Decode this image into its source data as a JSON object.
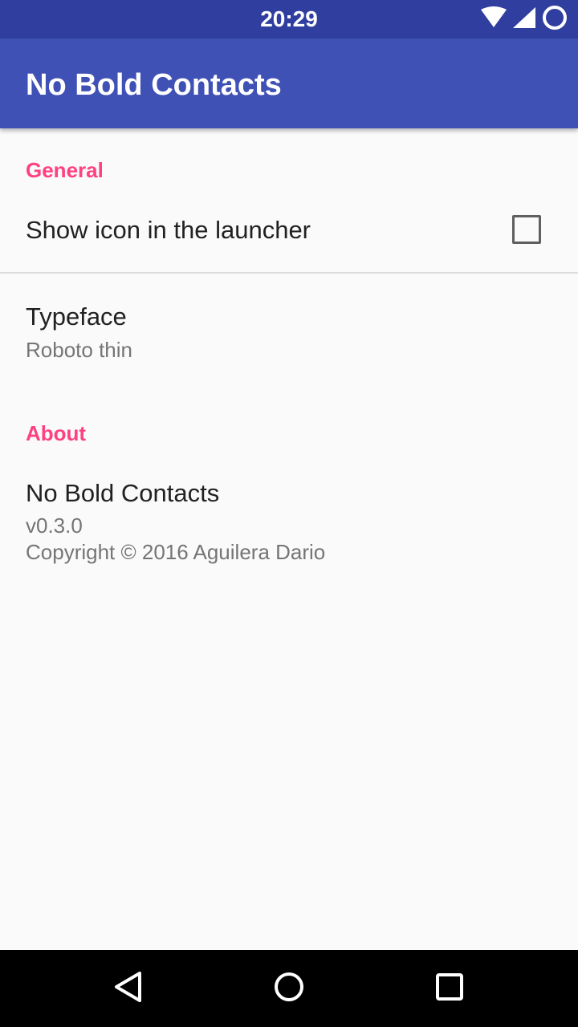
{
  "status_bar": {
    "time": "20:29",
    "icons": [
      "wifi-icon",
      "cell-signal-icon",
      "sync-circle-icon"
    ]
  },
  "app_bar": {
    "title": "No Bold Contacts",
    "color": "#3f51b5",
    "status_color": "#303f9f"
  },
  "sections": {
    "general": {
      "header": "General",
      "show_icon": {
        "title": "Show icon in the launcher",
        "checked": false
      },
      "typeface": {
        "title": "Typeface",
        "summary": "Roboto thin"
      }
    },
    "about": {
      "header": "About",
      "app_info": {
        "title": "No Bold Contacts",
        "version": "v0.3.0",
        "copyright": "Copyright © 2016 Aguilera Dario"
      }
    }
  },
  "nav_bar": {
    "back": "back-icon",
    "home": "home-icon",
    "recents": "recents-icon"
  },
  "colors": {
    "accent": "#ff4081",
    "background": "#fafafa"
  }
}
